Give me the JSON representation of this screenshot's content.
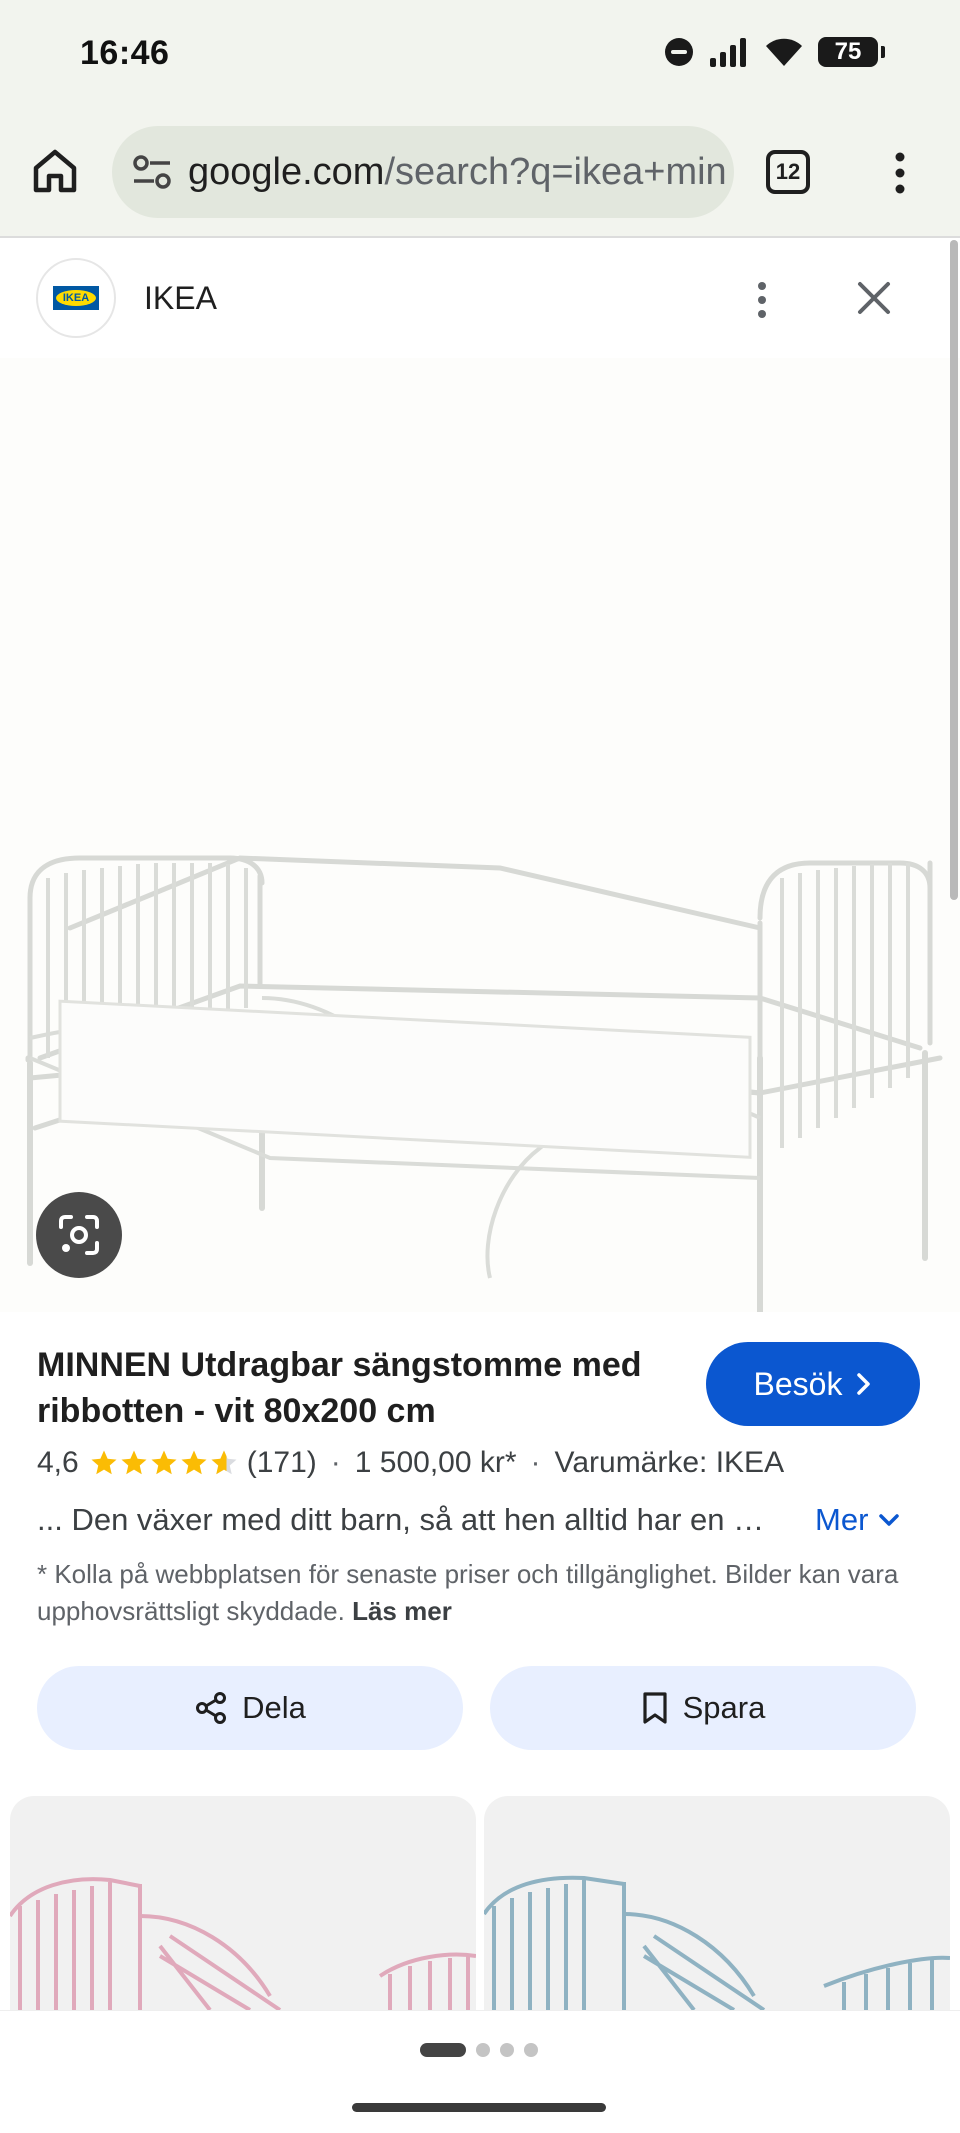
{
  "status_bar": {
    "time": "16:46",
    "battery": "75"
  },
  "browser": {
    "url_host": "google.com",
    "url_rest": "/search?q=ikea+minnen",
    "tab_count": "12"
  },
  "source": {
    "logo_text": "IKEA",
    "name": "IKEA"
  },
  "product": {
    "title": "MINNEN Utdragbar sängstomme med ribbotten - vit 80x200 cm",
    "visit_label": "Besök",
    "rating": "4,6",
    "rating_stars": 4.6,
    "review_count": "(171)",
    "price": "1 500,00 kr*",
    "brand": "Varumärke: IKEA",
    "description": "... Den växer med ditt barn, så att hen alltid har en bekväm säng att sova i",
    "more_label": "Mer",
    "disclaimer": "* Kolla på webbplatsen för senaste priser och tillgänglighet. Bilder kan vara upphovsrättsligt skyddade.",
    "read_more": "Läs mer",
    "share_label": "Dela",
    "save_label": "Spara"
  },
  "colors": {
    "accent": "#0b57d0",
    "chip_bg": "#e8efff",
    "star": "#fbbc04",
    "related_pink": "#e0a9bb",
    "related_blue": "#8fb2c2"
  },
  "pager": {
    "pages": 4,
    "current": 1
  }
}
